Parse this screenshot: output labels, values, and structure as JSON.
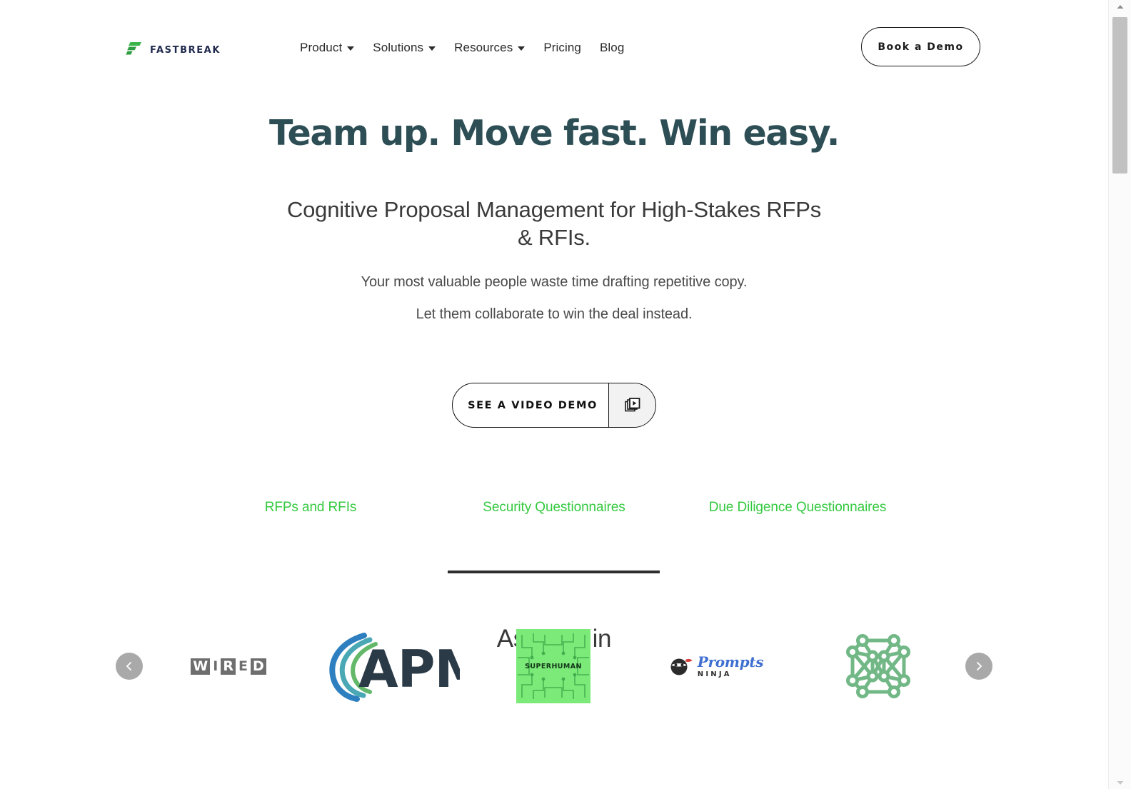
{
  "brand": {
    "name": "FASTBREAK",
    "mark_icon": "fastbreak-f-mark-icon",
    "mark_color": "#3bb54a"
  },
  "nav": {
    "items": [
      {
        "label": "Product",
        "has_dropdown": true
      },
      {
        "label": "Solutions",
        "has_dropdown": true
      },
      {
        "label": "Resources",
        "has_dropdown": true
      },
      {
        "label": "Pricing",
        "has_dropdown": false
      },
      {
        "label": "Blog",
        "has_dropdown": false
      }
    ],
    "cta_label": "Book a Demo"
  },
  "hero": {
    "headline": "Team up. Move fast. Win easy.",
    "headline_color": "#2d4e55",
    "subheadline": "Cognitive Proposal Management for High-Stakes RFPs & RFIs.",
    "body_line_1": "Your most valuable people waste time drafting repetitive copy.",
    "body_line_2": "Let them collaborate to win the deal instead.",
    "video_button_label": "SEE A VIDEO DEMO",
    "video_button_icon": "video-library-icon"
  },
  "use_cases": {
    "link_color": "#34c93f",
    "items": [
      {
        "label": "RFPs and RFIs"
      },
      {
        "label": "Security Questionnaires"
      },
      {
        "label": "Due Diligence Questionnaires"
      }
    ]
  },
  "as_seen_in": {
    "title": "As seen in",
    "logos": [
      {
        "name": "WIRED",
        "kind": "wired",
        "letters": [
          "W",
          "I",
          "R",
          "E",
          "D"
        ]
      },
      {
        "name": "APMP",
        "kind": "apmp",
        "text": "APMP"
      },
      {
        "name": "SUPERHUMAN",
        "kind": "superhuman",
        "text": "SUPERHUMAN",
        "tile_color": "#7bea79"
      },
      {
        "name": "Prompts Ninja",
        "kind": "promptsninja",
        "text_top": "Prompts",
        "text_bottom": "NINJA"
      },
      {
        "name": "Node Graph",
        "kind": "nodegraph",
        "color": "#72b887"
      }
    ],
    "prev_label": "‹",
    "next_label": "›"
  }
}
